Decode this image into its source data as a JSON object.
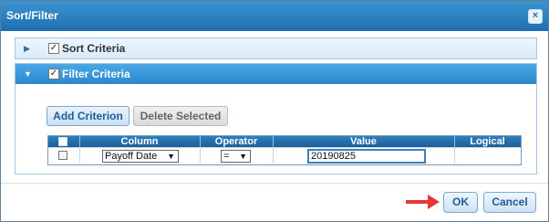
{
  "dialog": {
    "title": "Sort/Filter",
    "close_glyph": "×"
  },
  "sort_panel": {
    "label": "Sort Criteria",
    "checked": true,
    "expanded": false
  },
  "filter_panel": {
    "label": "Filter Criteria",
    "checked": true,
    "expanded": true,
    "buttons": {
      "add": "Add Criterion",
      "delete": "Delete Selected"
    },
    "columns": [
      "Column",
      "Operator",
      "Value",
      "Logical"
    ],
    "rows": [
      {
        "column": "Payoff Date",
        "operator": "=",
        "value": "20190825",
        "logical": ""
      }
    ]
  },
  "footer": {
    "ok": "OK",
    "cancel": "Cancel"
  },
  "colors": {
    "title_bar": "#2a7fc1",
    "filter_header": "#3a97db",
    "annotation_arrow": "#e53935"
  }
}
